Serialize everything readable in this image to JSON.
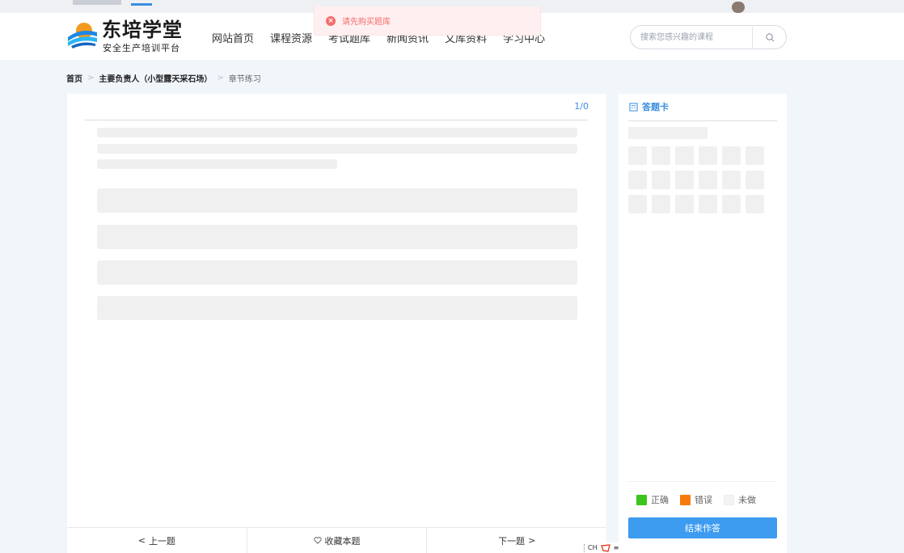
{
  "toast": {
    "message": "请先购买题库"
  },
  "header": {
    "brand": "东培学堂",
    "slogan": "安全生产培训平台",
    "nav": [
      "网站首页",
      "课程资源",
      "考试题库",
      "新闻资讯",
      "文库资料",
      "学习中心"
    ],
    "search_placeholder": "搜索您感兴趣的课程"
  },
  "breadcrumb": {
    "home": "首页",
    "category": "主要负责人（小型露天采石场）",
    "current": "章节练习"
  },
  "question": {
    "counter": "1/0"
  },
  "bottombar": {
    "prev": "上一题",
    "favorite": "收藏本题",
    "next": "下一题"
  },
  "answer_card": {
    "title": "答题卡",
    "legend": [
      {
        "label": "正确",
        "color": "#3cc51f"
      },
      {
        "label": "错误",
        "color": "#f77a0c"
      },
      {
        "label": "未做",
        "color": "#f3f3f3"
      }
    ],
    "end_button": "结束作答"
  },
  "ime": {
    "label": "CH"
  },
  "colors": {
    "accent": "#3b8de0",
    "button": "#3d9bf0",
    "error": "#f56c6c"
  }
}
